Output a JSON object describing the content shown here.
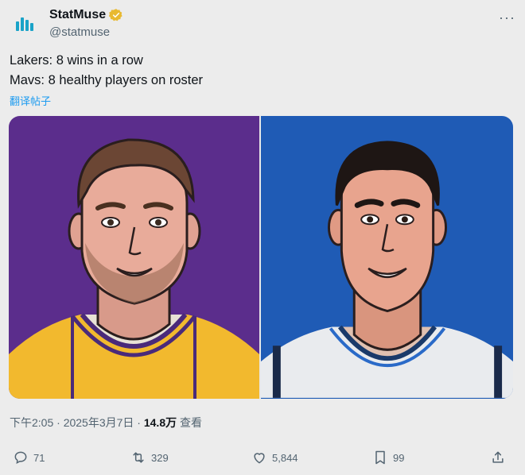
{
  "author": {
    "display_name": "StatMuse",
    "handle": "@statmuse",
    "verified_color": "#e8b931"
  },
  "more_icon": "···",
  "tweet": {
    "line1": "Lakers: 8 wins in a row",
    "line2": "Mavs: 8 healthy players on roster",
    "translate_label": "翻译帖子"
  },
  "media": {
    "left_bg": "#5b2d8c",
    "right_bg": "#1f5bb5"
  },
  "meta": {
    "time": "下午2:05 · 2025年3月7日 · ",
    "views": "14.8万",
    "views_label": " 查看"
  },
  "actions": {
    "replies": "71",
    "retweets": "329",
    "likes": "5,844",
    "bookmarks": "99"
  },
  "icons": [
    "statmuse-logo-icon",
    "verified-badge-icon",
    "more-icon",
    "reply-icon",
    "retweet-icon",
    "like-icon",
    "bookmark-icon",
    "share-icon"
  ]
}
